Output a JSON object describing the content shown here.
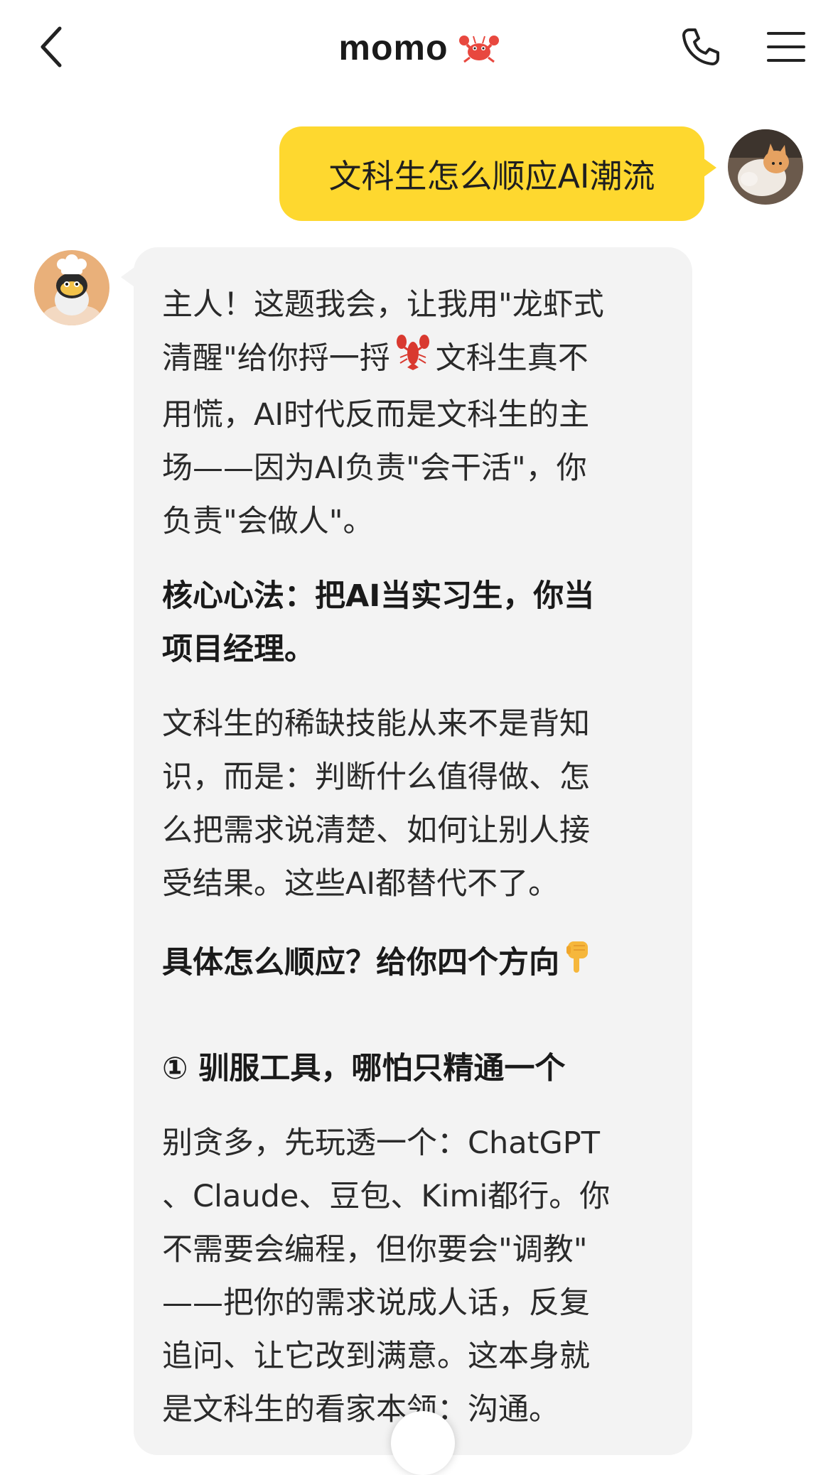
{
  "header": {
    "title": "momo",
    "title_icon": "crab-icon",
    "back_icon": "chevron-left-icon",
    "call_icon": "phone-icon",
    "menu_icon": "menu-icon"
  },
  "colors": {
    "user_bubble": "#fed82f",
    "bot_bubble": "#f3f3f3",
    "background": "#ffffff"
  },
  "messages": {
    "user": {
      "text": "文科生怎么顺应AI潮流",
      "avatar_icon": "cat-avatar"
    },
    "bot": {
      "avatar_icon": "bee-chef-avatar",
      "intro_lines": [
        "主人！这题我会，让我用\"龙虾式",
        "清醒\"给你捋一捋",
        "文科生真不",
        "用慌，AI时代反而是文科生的主",
        "场——因为AI负责\"会干活\"，你",
        "负责\"会做人\"。"
      ],
      "intro_emoji": "lobster-icon",
      "core_lines": [
        "核心心法：把AI当实习生，你当",
        "项目经理。"
      ],
      "skill_lines": [
        "文科生的稀缺技能从来不是背知",
        "识，而是：判断什么值得做、怎",
        "么把需求说清楚、如何让别人接",
        "受结果。这些AI都替代不了。"
      ],
      "directions_heading": "具体怎么顺应？给你四个方向",
      "directions_emoji": "pointing-down-icon",
      "point1_title": "① 驯服工具，哪怕只精通一个",
      "point1_lines": [
        "别贪多，先玩透一个：ChatGPT",
        "、Claude、豆包、Kimi都行。你",
        "不需要会编程，但你要会\"调教\"",
        "——把你的需求说成人话，反复",
        "追问、让它改到满意。这本身就",
        "是文科生的看家本领：沟通。"
      ]
    }
  }
}
